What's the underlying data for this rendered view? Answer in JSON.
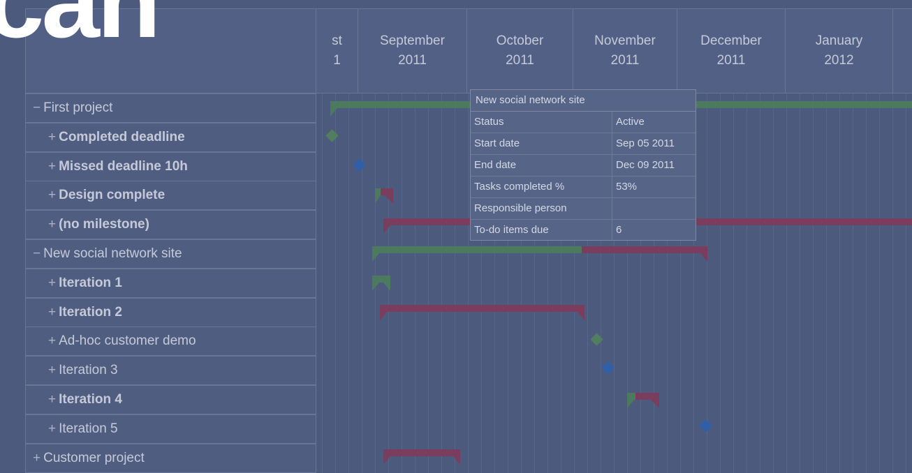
{
  "overlay_text": "can",
  "months": [
    {
      "line1": "st",
      "line2": "1"
    },
    {
      "line1": "September",
      "line2": "2011"
    },
    {
      "line1": "October",
      "line2": "2011"
    },
    {
      "line1": "November",
      "line2": "2011"
    },
    {
      "line1": "December",
      "line2": "2011"
    },
    {
      "line1": "January",
      "line2": "2012"
    }
  ],
  "tasks": [
    {
      "sign": "−",
      "label": "First project",
      "level": 0,
      "bold": false
    },
    {
      "sign": "+",
      "label": "Completed deadline",
      "level": 1,
      "bold": true
    },
    {
      "sign": "+",
      "label": "Missed deadline 10h",
      "level": 1,
      "bold": true
    },
    {
      "sign": "+",
      "label": "Design complete",
      "level": 1,
      "bold": true
    },
    {
      "sign": "+",
      "label": "(no milestone)",
      "level": 1,
      "bold": true
    },
    {
      "sign": "−",
      "label": "New social network site",
      "level": 0,
      "bold": false
    },
    {
      "sign": "+",
      "label": "Iteration 1",
      "level": 1,
      "bold": true
    },
    {
      "sign": "+",
      "label": "Iteration 2",
      "level": 1,
      "bold": true
    },
    {
      "sign": "+",
      "label": "Ad-hoc customer demo",
      "level": 1,
      "bold": false
    },
    {
      "sign": "+",
      "label": "Iteration 3",
      "level": 1,
      "bold": false
    },
    {
      "sign": "+",
      "label": "Iteration 4",
      "level": 1,
      "bold": true
    },
    {
      "sign": "+",
      "label": "Iteration 5",
      "level": 1,
      "bold": false
    },
    {
      "sign": "+",
      "label": "Customer project",
      "level": 0,
      "bold": false
    }
  ],
  "tooltip": {
    "title": "New social network site",
    "rows": [
      {
        "key": "Status",
        "value": "Active"
      },
      {
        "key": "Start date",
        "value": "Sep 05 2011"
      },
      {
        "key": "End date",
        "value": "Dec 09 2011"
      },
      {
        "key": "Tasks completed %",
        "value": "53%"
      },
      {
        "key": "Responsible person",
        "value": ""
      },
      {
        "key": "To-do items due",
        "value": "6"
      }
    ]
  },
  "colors": {
    "green": "#4c7a5e",
    "red": "#7a3d5e",
    "blue": "#2f5fa8",
    "diamond_green": "#4f7f5f"
  }
}
